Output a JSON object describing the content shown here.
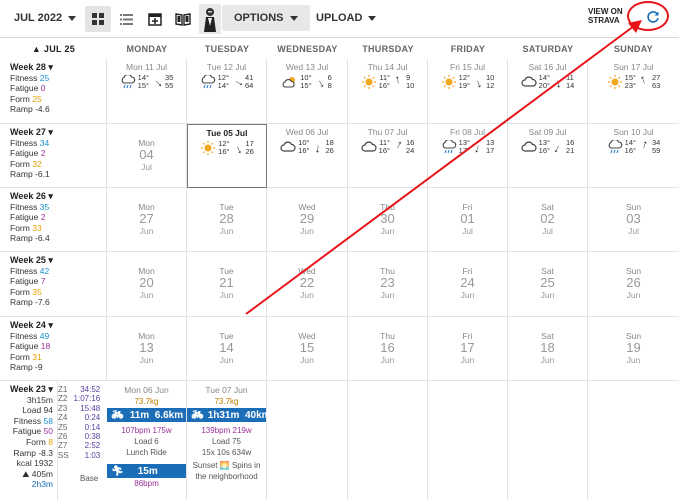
{
  "toolbar": {
    "month": "JUL 2022",
    "options": "OPTIONS",
    "upload": "UPLOAD",
    "view_on": "VIEW ON",
    "strava": "STRAVA"
  },
  "header": {
    "jump": "JUL 25",
    "days": [
      "MONDAY",
      "TUESDAY",
      "WEDNESDAY",
      "THURSDAY",
      "FRIDAY",
      "SATURDAY",
      "SUNDAY"
    ]
  },
  "weeks": [
    {
      "label": "Week 28",
      "fitness": "Fitness",
      "fitness_v": "25",
      "fatigue": "Fatigue",
      "fatigue_v": "0",
      "form": "Form",
      "form_v": "25",
      "ramp": "Ramp -4.6",
      "days": [
        {
          "d": "Mon 11 Jul",
          "hi": "14°",
          "lo": "15°",
          "w1": "35",
          "w2": "55"
        },
        {
          "d": "Tue 12 Jul",
          "hi": "12°",
          "lo": "14°",
          "w1": "41",
          "w2": "64"
        },
        {
          "d": "Wed 13 Jul",
          "hi": "10°",
          "lo": "15°",
          "w1": "6",
          "w2": "8"
        },
        {
          "d": "Thu 14 Jul",
          "hi": "11°",
          "lo": "16°",
          "w1": "9",
          "w2": "10"
        },
        {
          "d": "Fri 15 Jul",
          "hi": "12°",
          "lo": "19°",
          "w1": "10",
          "w2": "12"
        },
        {
          "d": "Sat 16 Jul",
          "hi": "14°",
          "lo": "20°",
          "w1": "11",
          "w2": "14"
        },
        {
          "d": "Sun 17 Jul",
          "hi": "15°",
          "lo": "23°",
          "w1": "27",
          "w2": "63"
        }
      ]
    },
    {
      "label": "Week 27",
      "fitness": "Fitness",
      "fitness_v": "34",
      "fatigue": "Fatigue",
      "fatigue_v": "2",
      "form": "Form",
      "form_v": "32",
      "ramp": "Ramp -6.1",
      "days": [
        {
          "dn": "Mon",
          "n": "04",
          "m": "Jul"
        },
        {
          "d": "Tue 05 Jul",
          "hi": "12°",
          "lo": "16°",
          "w1": "17",
          "w2": "26"
        },
        {
          "d": "Wed 06 Jul",
          "hi": "10°",
          "lo": "16°",
          "w1": "18",
          "w2": "26"
        },
        {
          "d": "Thu 07 Jul",
          "hi": "11°",
          "lo": "16°",
          "w1": "16",
          "w2": "24"
        },
        {
          "d": "Fri 08 Jul",
          "hi": "13°",
          "lo": "17°",
          "w1": "13",
          "w2": "17"
        },
        {
          "d": "Sat 09 Jul",
          "hi": "13°",
          "lo": "16°",
          "w1": "16",
          "w2": "21"
        },
        {
          "d": "Sun 10 Jul",
          "hi": "14°",
          "lo": "16°",
          "w1": "34",
          "w2": "59"
        }
      ]
    },
    {
      "label": "Week 26",
      "fitness": "Fitness",
      "fitness_v": "35",
      "fatigue": "Fatigue",
      "fatigue_v": "2",
      "form": "Form",
      "form_v": "33",
      "ramp": "Ramp -6.4",
      "days": [
        {
          "dn": "Mon",
          "n": "27",
          "m": "Jun"
        },
        {
          "dn": "Tue",
          "n": "28",
          "m": "Jun"
        },
        {
          "dn": "Wed",
          "n": "29",
          "m": "Jun"
        },
        {
          "dn": "Thu",
          "n": "30",
          "m": "Jun"
        },
        {
          "dn": "Fri",
          "n": "01",
          "m": "Jul"
        },
        {
          "dn": "Sat",
          "n": "02",
          "m": "Jul"
        },
        {
          "dn": "Sun",
          "n": "03",
          "m": "Jul"
        }
      ]
    },
    {
      "label": "Week 25",
      "fitness": "Fitness",
      "fitness_v": "42",
      "fatigue": "Fatigue",
      "fatigue_v": "7",
      "form": "Form",
      "form_v": "35",
      "ramp": "Ramp -7.6",
      "days": [
        {
          "dn": "Mon",
          "n": "20",
          "m": "Jun"
        },
        {
          "dn": "Tue",
          "n": "21",
          "m": "Jun"
        },
        {
          "dn": "Wed",
          "n": "22",
          "m": "Jun"
        },
        {
          "dn": "Thu",
          "n": "23",
          "m": "Jun"
        },
        {
          "dn": "Fri",
          "n": "24",
          "m": "Jun"
        },
        {
          "dn": "Sat",
          "n": "25",
          "m": "Jun"
        },
        {
          "dn": "Sun",
          "n": "26",
          "m": "Jun"
        }
      ]
    },
    {
      "label": "Week 24",
      "fitness": "Fitness",
      "fitness_v": "49",
      "fatigue": "Fatigue",
      "fatigue_v": "18",
      "form": "Form",
      "form_v": "31",
      "ramp": "Ramp -9",
      "days": [
        {
          "dn": "Mon",
          "n": "13",
          "m": "Jun"
        },
        {
          "dn": "Tue",
          "n": "14",
          "m": "Jun"
        },
        {
          "dn": "Wed",
          "n": "15",
          "m": "Jun"
        },
        {
          "dn": "Thu",
          "n": "16",
          "m": "Jun"
        },
        {
          "dn": "Fri",
          "n": "17",
          "m": "Jun"
        },
        {
          "dn": "Sat",
          "n": "18",
          "m": "Jun"
        },
        {
          "dn": "Sun",
          "n": "19",
          "m": "Jun"
        }
      ]
    }
  ],
  "week23": {
    "label": "Week 23",
    "time": "3h15m",
    "load": "Load 94",
    "fitness": "Fitness",
    "fitness_v": "58",
    "fatigue": "Fatigue",
    "fatigue_v": "50",
    "form": "Form",
    "form_v": "8",
    "ramp": "Ramp -8.3",
    "kcal": "kcal 1932",
    "dist": "405m",
    "run": "2h3m",
    "zones": [
      [
        "Z1",
        "34:52"
      ],
      [
        "Z2",
        "1:07:16"
      ],
      [
        "Z3",
        "15:48"
      ],
      [
        "Z4",
        "0:24"
      ],
      [
        "Z5",
        "0:14"
      ],
      [
        "Z6",
        "0:38"
      ],
      [
        "Z7",
        "2:52"
      ],
      [
        "SS",
        "1:03"
      ]
    ],
    "base": "Base",
    "mon": {
      "d": "Mon 06 Jun",
      "weight": "73.7kg",
      "time": "11m",
      "dist": "6.6km",
      "hr": "107bpm",
      "pw": "175w",
      "load": "Load 6",
      "name": "Lunch Ride",
      "run": "15m",
      "run_hr": "86bpm"
    },
    "tue": {
      "d": "Tue 07 Jun",
      "weight": "73.7kg",
      "time": "1h31m",
      "dist": "40km",
      "hr": "139bpm",
      "pw": "219w",
      "load": "Load 75",
      "intervals": "15x 10s 634w",
      "name1": "Sunset",
      "name2": "Spins in",
      "name3": "the neighborhood"
    }
  }
}
